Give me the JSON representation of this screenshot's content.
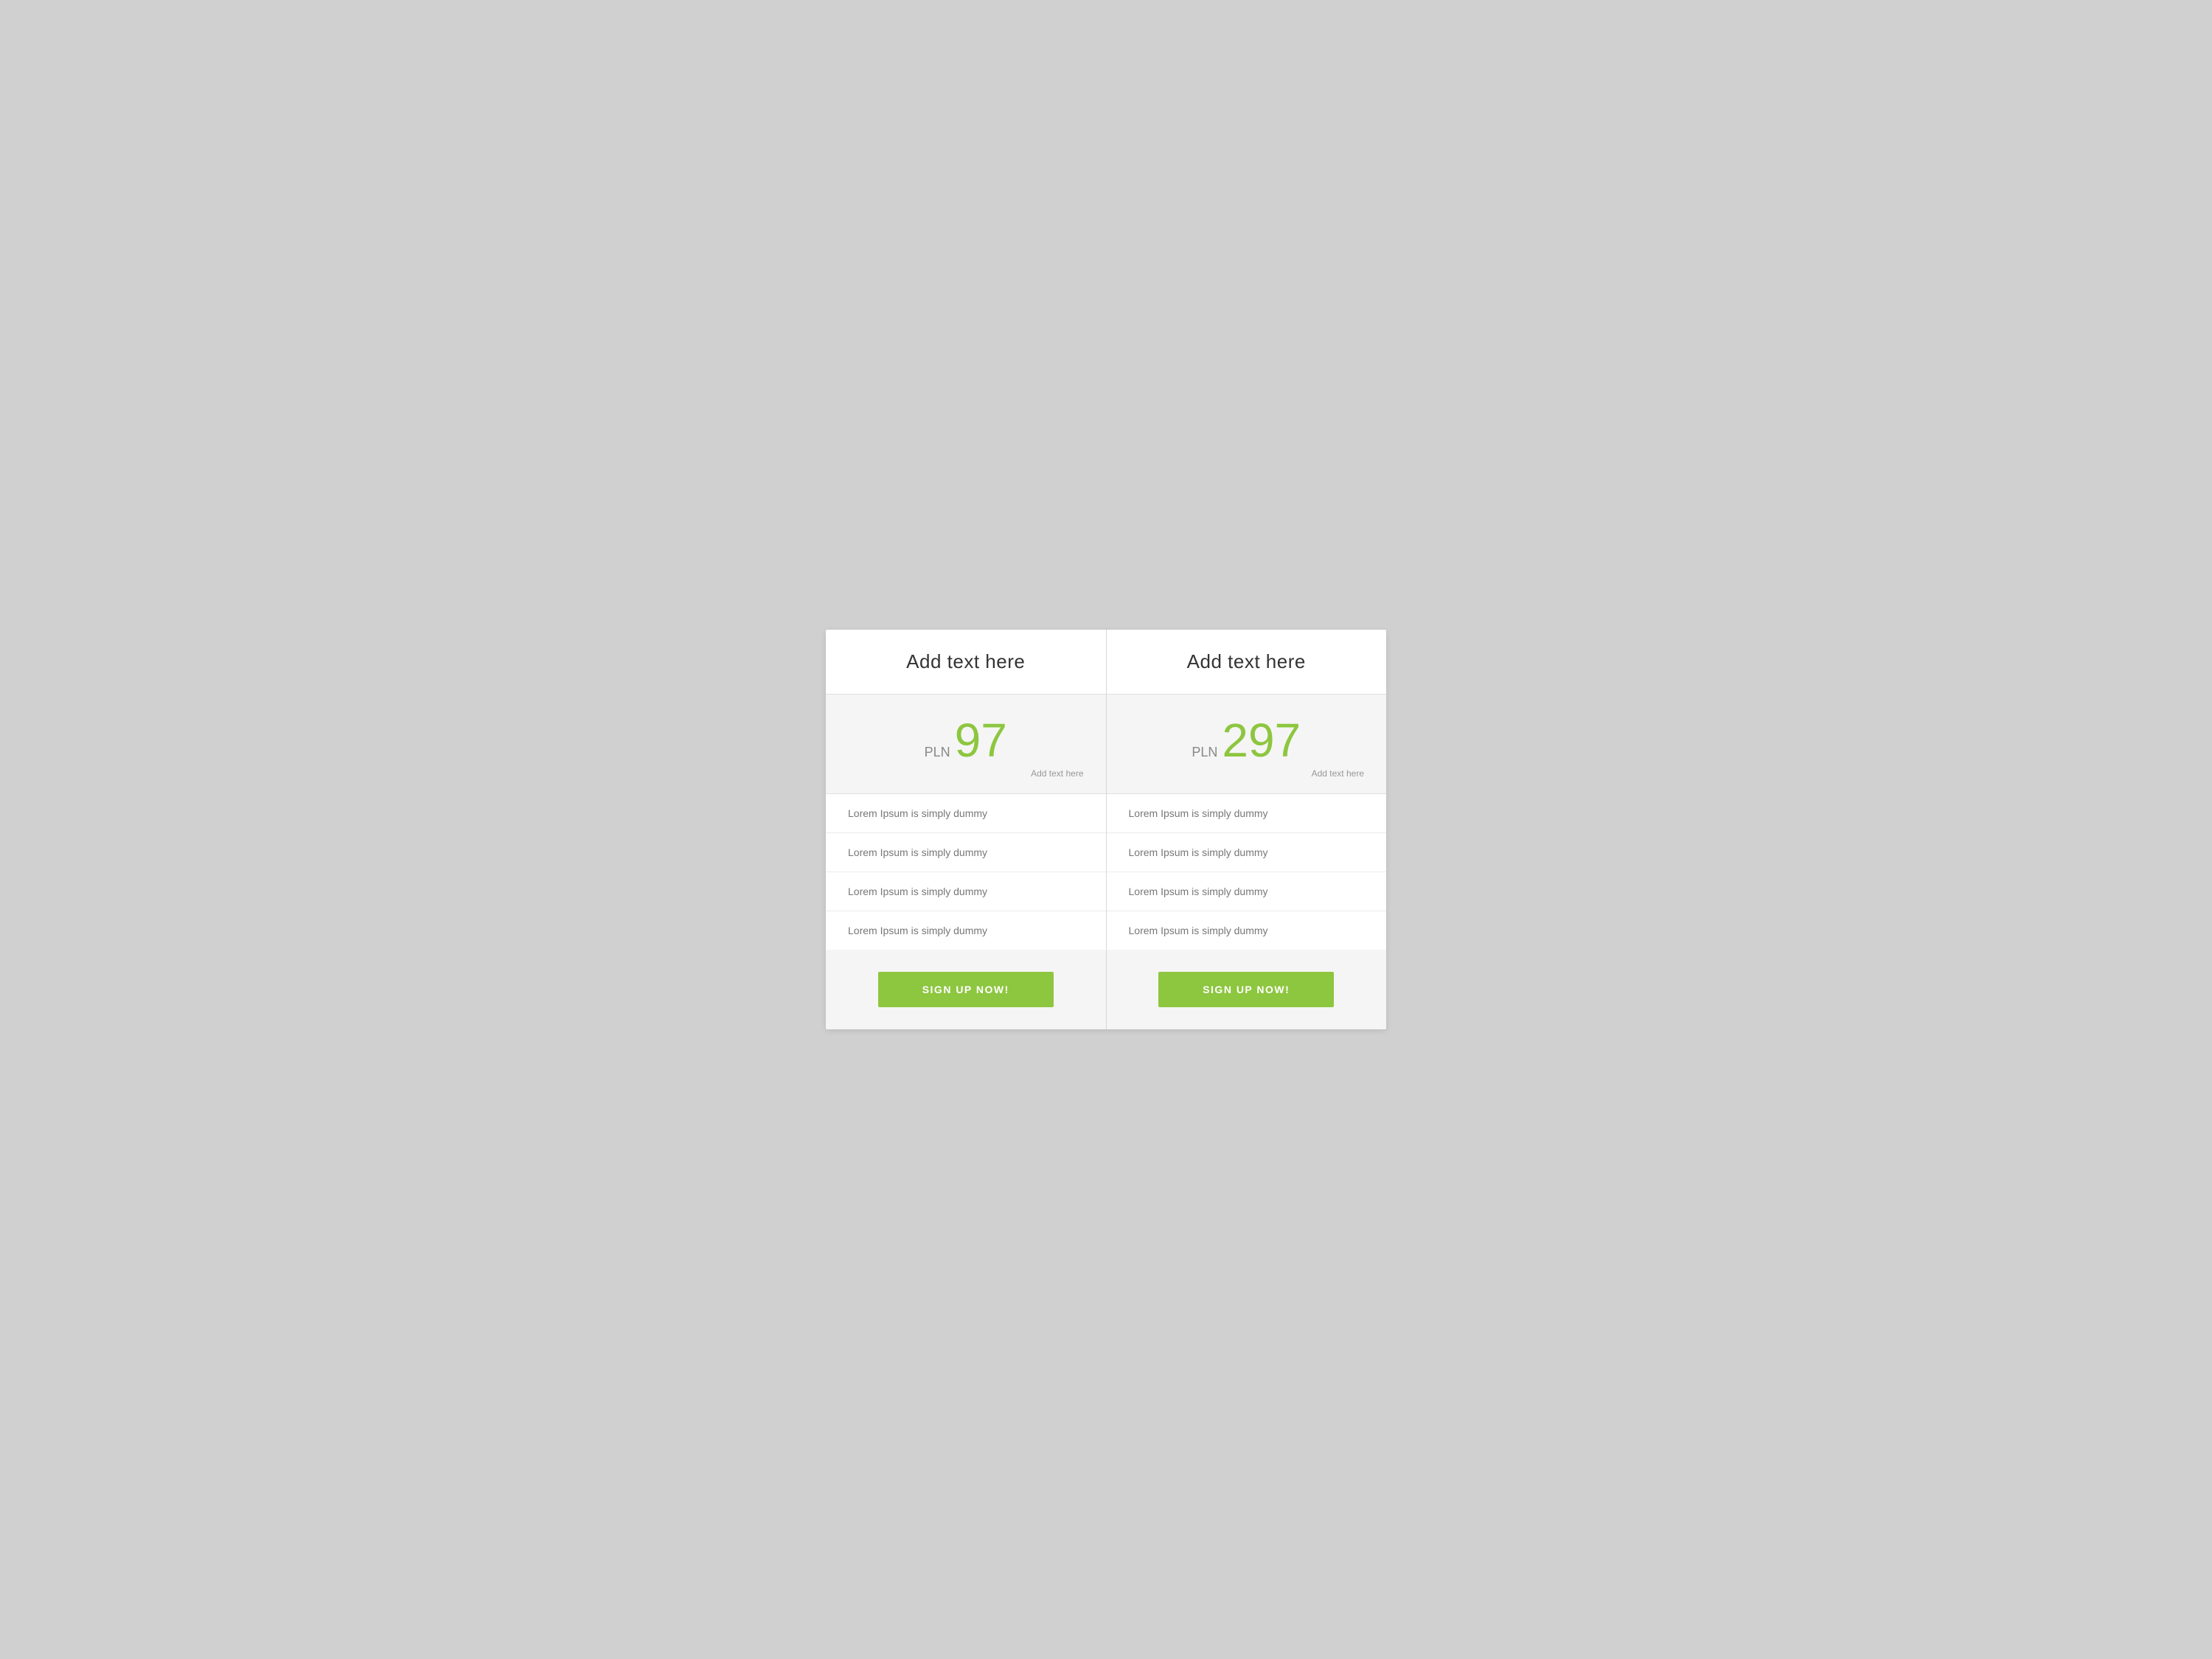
{
  "pricing": {
    "accent_color": "#8dc63f",
    "plans": [
      {
        "id": "plan-left",
        "header_title": "Add text here",
        "currency": "PLN",
        "amount": "97",
        "price_note": "Add text here",
        "features": [
          "Lorem Ipsum is simply dummy",
          "Lorem Ipsum is simply dummy",
          "Lorem Ipsum is simply dummy",
          "Lorem Ipsum is simply dummy"
        ],
        "button_label": "SIGN UP NOW!"
      },
      {
        "id": "plan-right",
        "header_title": "Add text here",
        "currency": "PLN",
        "amount": "297",
        "price_note": "Add text here",
        "features": [
          "Lorem Ipsum is simply dummy",
          "Lorem Ipsum is simply dummy",
          "Lorem Ipsum is simply dummy",
          "Lorem Ipsum is simply dummy"
        ],
        "button_label": "SIGN UP NOW!"
      }
    ]
  }
}
